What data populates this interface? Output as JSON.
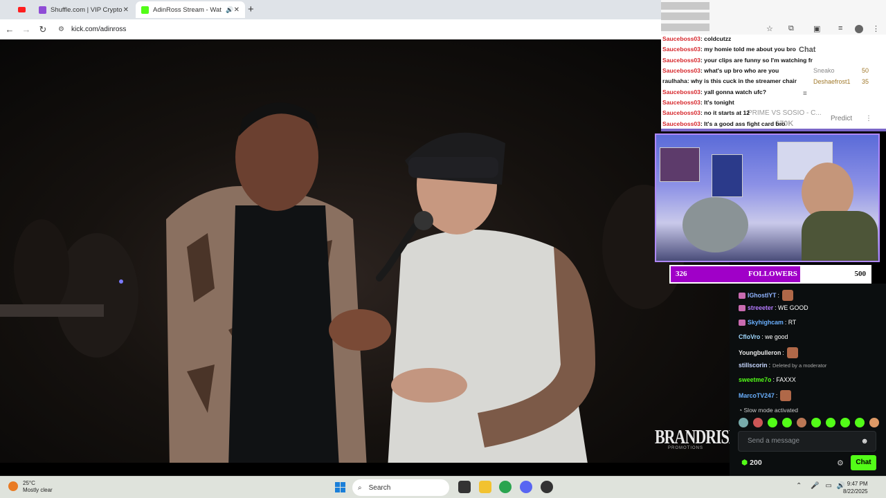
{
  "browser": {
    "tabs": [
      {
        "title": "Shuffle.com | VIP Crypto Casino",
        "color": "#8f4cd6"
      },
      {
        "title": "AdinRoss Stream - Watch Live",
        "color": "#53fc18"
      }
    ],
    "new_tab": "+",
    "url": "kick.com/adinross",
    "back": "←",
    "forward": "→",
    "reload": "↻"
  },
  "overlay_chat": [
    {
      "user": "Sauceboss03",
      "text": ": coldcutzz"
    },
    {
      "user": "Sauceboss03",
      "text": ": my homie told me about you bro"
    },
    {
      "user": "Sauceboss03",
      "text": ": your clips are funny so I'm watching fr"
    },
    {
      "user": "Sauceboss03",
      "text": ": what's up bro who are you"
    },
    {
      "user": "raulhaha",
      "text": ": why is this cuck in the streamer chair"
    },
    {
      "user": "Sauceboss03",
      "text": ": yall gonna watch ufc?"
    },
    {
      "user": "Sauceboss03",
      "text": ": It's tonight"
    },
    {
      "user": "Sauceboss03",
      "text": ": no it starts at 12"
    },
    {
      "user": "Sauceboss03",
      "text": ": It's a good ass fight card bro"
    }
  ],
  "sidebar": {
    "heading": "Chat",
    "leaderboard": [
      {
        "name": "Sneako",
        "points": "50"
      },
      {
        "name": "Deshaefrost1",
        "points": "35"
      }
    ],
    "stream_title": "PRIME VS SOSIO - C...",
    "viewers": "670K",
    "predict": "Predict"
  },
  "followers": {
    "current": "326",
    "label": "FOLLOWERS",
    "goal": "500",
    "progress": 0.65
  },
  "chat": {
    "messages": [
      {
        "user": "IGhostIYT",
        "text": ":",
        "color": "#8fb3ff",
        "badge": true,
        "emote": true
      },
      {
        "user": "streeeter",
        "text": ": WE GOOD",
        "color": "#b57bff",
        "badge": true,
        "emote": false
      },
      {
        "user": "Skyhighcam",
        "text": ": RT",
        "color": "#6ab0ff",
        "badge": true,
        "emote": false
      },
      {
        "user": "CfloVro",
        "text": ": we good",
        "color": "#9fd8ff",
        "badge": false,
        "emote": false
      },
      {
        "user": "Youngbulleron",
        "text": ":",
        "color": "#e8e8e8",
        "badge": false,
        "emote": true
      },
      {
        "user": "stillscorin",
        "text": ":",
        "color": "#c7d7ff",
        "badge": false,
        "emote": false,
        "deleted": "Deleted by a moderator"
      },
      {
        "user": "sweetme7o",
        "text": ": FAXXX",
        "color": "#53fc18",
        "badge": false,
        "emote": false
      },
      {
        "user": "MarcoTV247",
        "text": ":",
        "color": "#6ab0ff",
        "badge": false,
        "emote": true
      }
    ],
    "slow_mode": "Slow mode activated",
    "input_placeholder": "Send a message",
    "points": "200",
    "send_label": "Chat"
  },
  "video": {
    "watermark": "BRANDRISK",
    "watermark_sub": "PROMOTIONS"
  },
  "taskbar": {
    "weather_temp": "25°C",
    "weather_desc": "Mostly clear",
    "search_label": "Search",
    "time": "9:47 PM",
    "date": "8/22/2025"
  }
}
